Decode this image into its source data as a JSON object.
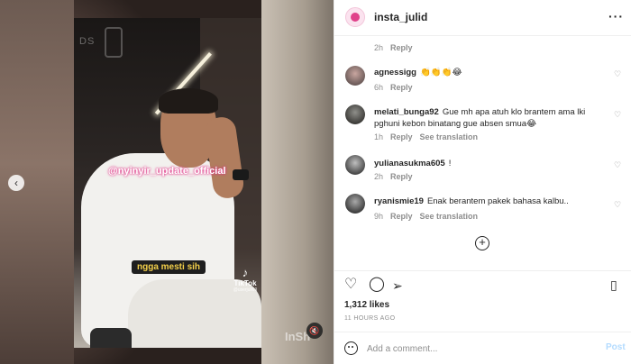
{
  "header": {
    "username": "insta_julid",
    "more_icon": "more-horizontal-icon"
  },
  "media": {
    "watermark": "@nyinyir_update_official",
    "caption_tag": "ngga mesti sih",
    "tiktok_name": "TikTok",
    "tiktok_handle": "@userjuli69",
    "corner_mark": "InSh",
    "logo_text": "DS",
    "prev_icon": "chevron-left-icon",
    "mute_icon": "speaker-muted-icon"
  },
  "top_meta": {
    "time": "2h",
    "reply": "Reply"
  },
  "comments": [
    {
      "username": "agnessigg",
      "text": "👏👏👏😂",
      "time": "6h",
      "reply": "Reply",
      "translation": ""
    },
    {
      "username": "melati_bunga92",
      "text": "Gue mh apa atuh klo brantem ama lki pghuni kebon binatang gue absen smua😂",
      "time": "1h",
      "reply": "Reply",
      "translation": "See translation"
    },
    {
      "username": "yulianasukma605",
      "text": "!",
      "time": "2h",
      "reply": "Reply",
      "translation": ""
    },
    {
      "username": "ryanismie19",
      "text": "Enak berantem pakek bahasa kalbu..",
      "time": "9h",
      "reply": "Reply",
      "translation": "See translation"
    }
  ],
  "actions": {
    "like_icon": "heart-icon",
    "comment_icon": "comment-icon",
    "share_icon": "paper-plane-icon",
    "save_icon": "bookmark-icon"
  },
  "likes": "1,312 likes",
  "time_ago": "11 HOURS AGO",
  "add_comment": {
    "placeholder": "Add a comment...",
    "post_label": "Post"
  },
  "colors": {
    "accent_pink": "#e0408a",
    "post_disabled": "#b3dbff",
    "muted_text": "#8e8e8e"
  }
}
